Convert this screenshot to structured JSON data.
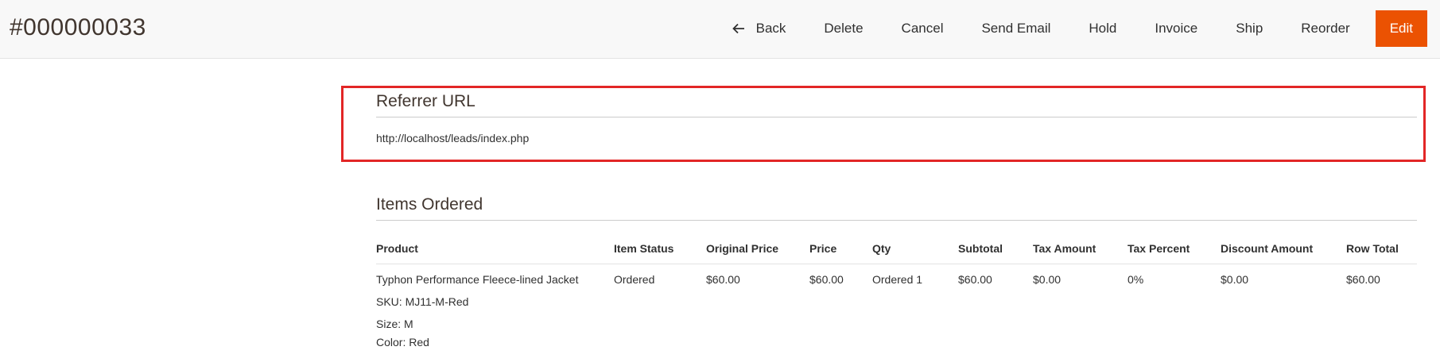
{
  "header": {
    "order_id": "#000000033",
    "actions": {
      "back": "Back",
      "delete": "Delete",
      "cancel": "Cancel",
      "send_email": "Send Email",
      "hold": "Hold",
      "invoice": "Invoice",
      "ship": "Ship",
      "reorder": "Reorder",
      "edit": "Edit"
    }
  },
  "referrer": {
    "title": "Referrer URL",
    "url": "http://localhost/leads/index.php"
  },
  "items_ordered": {
    "title": "Items Ordered",
    "columns": {
      "product": "Product",
      "item_status": "Item Status",
      "original_price": "Original Price",
      "price": "Price",
      "qty": "Qty",
      "subtotal": "Subtotal",
      "tax_amount": "Tax Amount",
      "tax_percent": "Tax Percent",
      "discount_amount": "Discount Amount",
      "row_total": "Row Total"
    },
    "rows": [
      {
        "product": "Typhon Performance Fleece-lined Jacket",
        "sku": "SKU: MJ11-M-Red",
        "size": "Size: M",
        "color": "Color: Red",
        "item_status": "Ordered",
        "original_price": "$60.00",
        "price": "$60.00",
        "qty": "Ordered 1",
        "subtotal": "$60.00",
        "tax_amount": "$0.00",
        "tax_percent": "0%",
        "discount_amount": "$0.00",
        "row_total": "$60.00"
      }
    ]
  },
  "colors": {
    "accent": "#eb5202",
    "highlight": "#e22626"
  },
  "icons": {
    "back": "arrow-left-icon"
  }
}
